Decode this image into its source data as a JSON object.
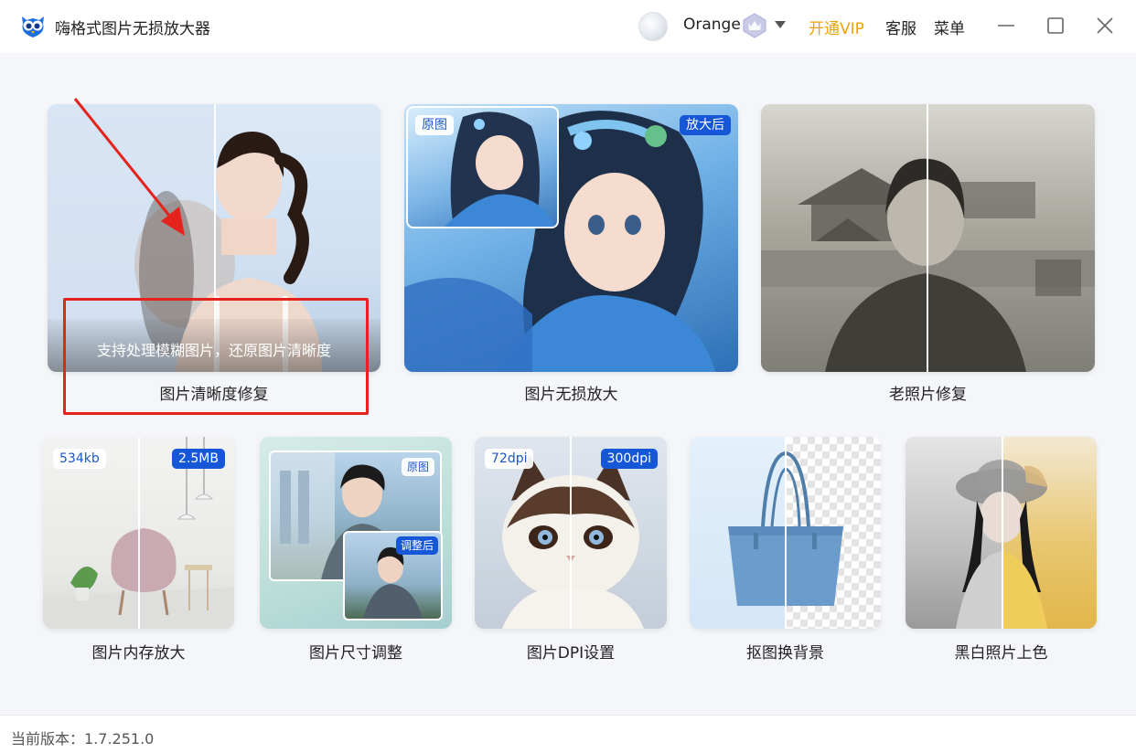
{
  "app": {
    "title": "嗨格式图片无损放大器"
  },
  "header": {
    "username": "Orange",
    "vip_label": "开通VIP",
    "service_label": "客服",
    "menu_label": "菜单"
  },
  "colors": {
    "vip_accent": "#f0a400",
    "tag_blue": "#1657d8",
    "annotation_red": "#e5231d"
  },
  "features_top": [
    {
      "label": "图片清晰度修复",
      "caption": "支持处理模糊图片，还原图片清晰度"
    },
    {
      "label": "图片无损放大",
      "tag_before": "原图",
      "tag_after": "放大后"
    },
    {
      "label": "老照片修复"
    }
  ],
  "features_bottom": [
    {
      "label": "图片内存放大",
      "tag_before": "534kb",
      "tag_after": "2.5MB"
    },
    {
      "label": "图片尺寸调整",
      "tag_before": "原图",
      "tag_after": "调整后"
    },
    {
      "label": "图片DPI设置",
      "tag_before": "72dpi",
      "tag_after": "300dpi"
    },
    {
      "label": "抠图换背景"
    },
    {
      "label": "黑白照片上色"
    }
  ],
  "footer": {
    "version": "当前版本：1.7.251.0"
  },
  "icons": [
    "owl-logo-icon",
    "user-avatar",
    "vip-crown-icon",
    "chevron-down-icon",
    "minimize-icon",
    "maximize-icon",
    "close-icon"
  ]
}
